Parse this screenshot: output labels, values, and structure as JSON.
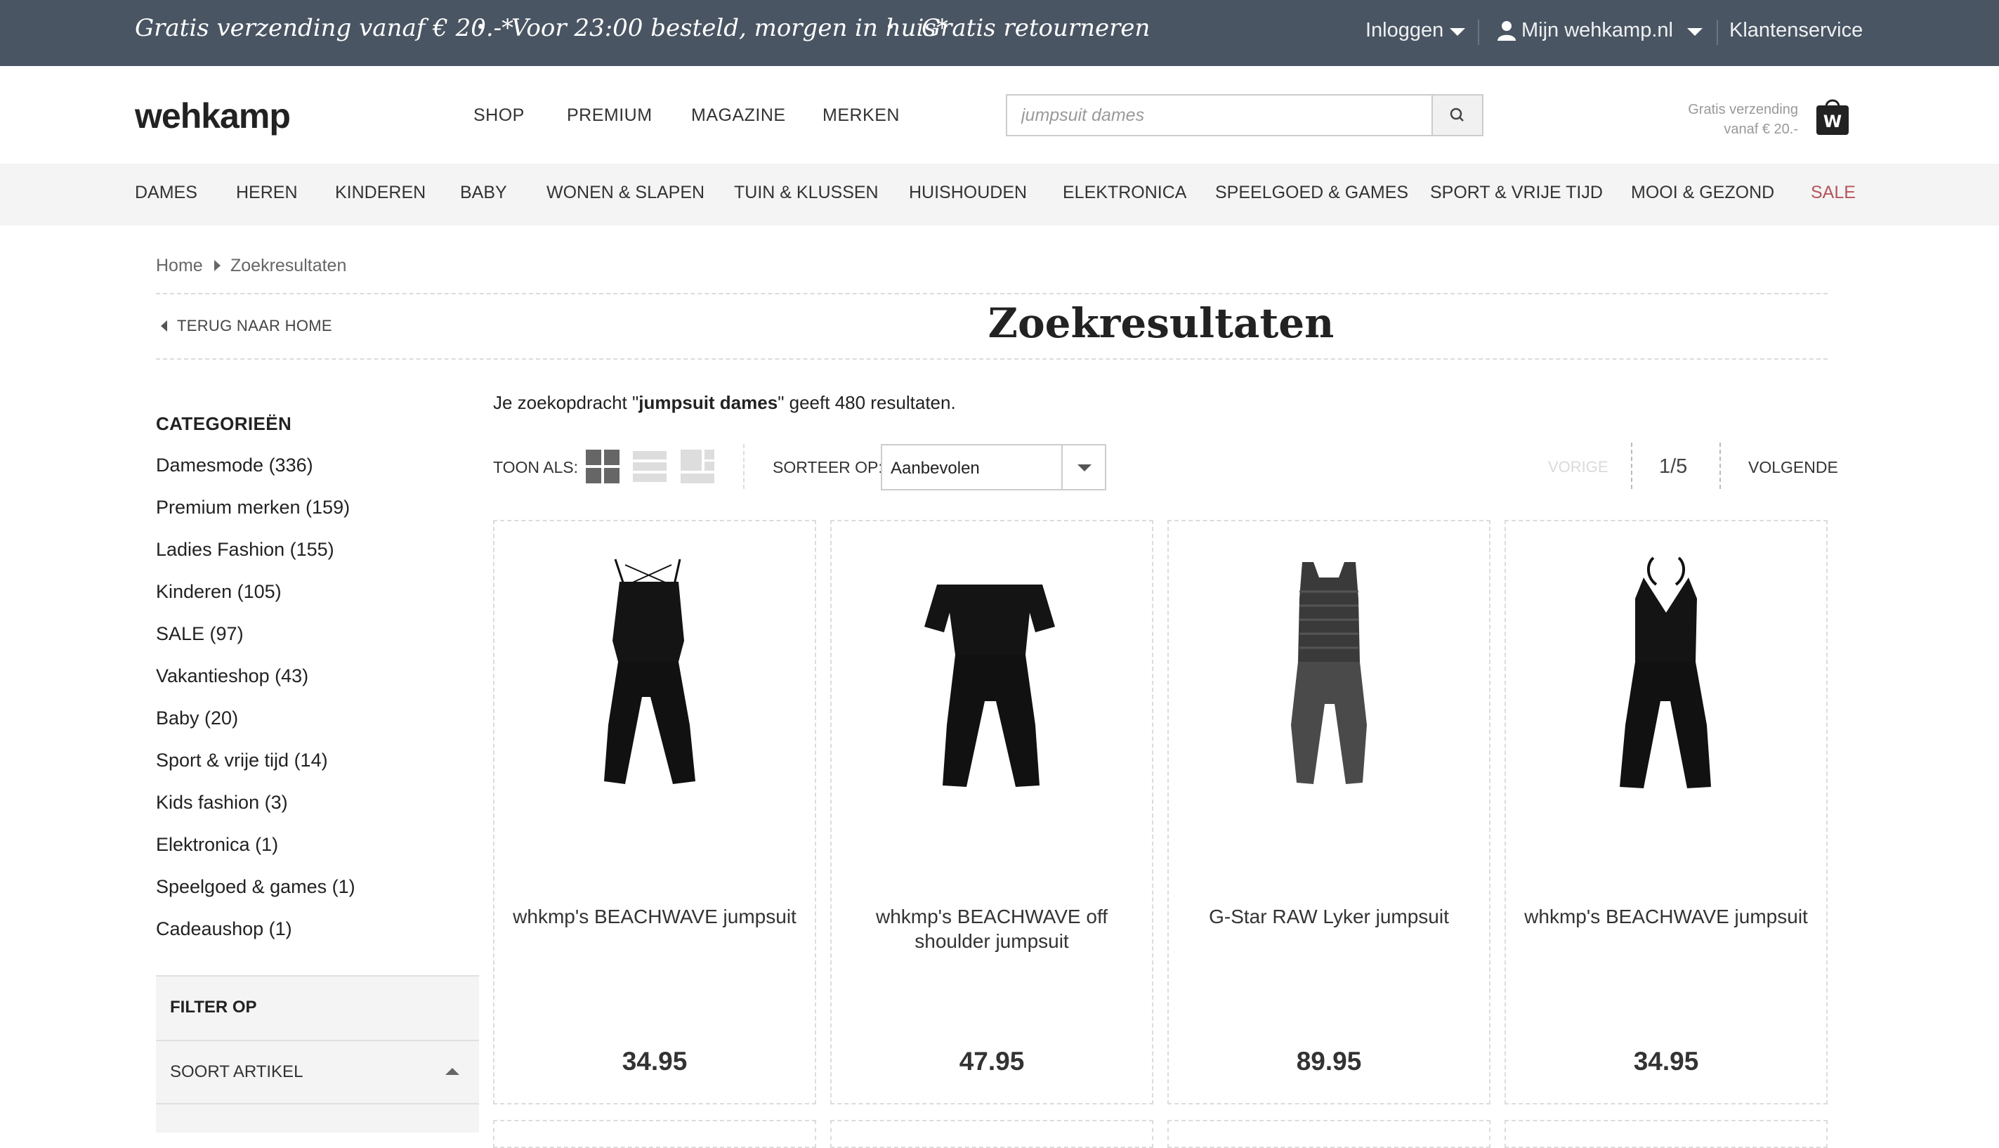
{
  "topbar": {
    "usps": [
      "Gratis verzending vanaf € 20.-*",
      "Voor 23:00 besteld, morgen in huis*",
      "Gratis retourneren"
    ],
    "login": "Inloggen",
    "account": "Mijn wehkamp.nl",
    "service": "Klantenservice",
    "icons": [
      "chevron-down-icon",
      "person-icon"
    ]
  },
  "header": {
    "logo": "wehkamp",
    "nav": [
      "SHOP",
      "PREMIUM",
      "MAGAZINE",
      "MERKEN"
    ],
    "search": {
      "value": "",
      "placeholder": "jumpsuit dames",
      "icon": "search-icon"
    },
    "shipping_line1": "Gratis verzending",
    "shipping_line2": "vanaf € 20.-",
    "bag_letter": "W"
  },
  "categories": [
    "DAMES",
    "HEREN",
    "KINDEREN",
    "BABY",
    "WONEN & SLAPEN",
    "TUIN & KLUSSEN",
    "HUISHOUDEN",
    "ELEKTRONICA",
    "SPEELGOED & GAMES",
    "SPORT & VRIJE TIJD",
    "MOOI & GEZOND",
    "SALE"
  ],
  "colors": {
    "topbar": "#4a5563",
    "sale": "#b5545c",
    "nav_bg": "#f4f4f4"
  },
  "breadcrumb": [
    "Home",
    "Zoekresultaten"
  ],
  "back_link": "TERUG NAAR HOME",
  "page_title": "Zoekresultaten",
  "sidebar": {
    "heading": "CATEGORIEËN",
    "items": [
      "Damesmode (336)",
      "Premium merken (159)",
      "Ladies Fashion (155)",
      "Kinderen (105)",
      "SALE (97)",
      "Vakantieshop (43)",
      "Baby (20)",
      "Sport & vrije tijd (14)",
      "Kids fashion (3)",
      "Elektronica (1)",
      "Speelgoed & games (1)",
      "Cadeaushop (1)"
    ],
    "filter_heading": "FILTER OP",
    "filter_section": "SOORT ARTIKEL"
  },
  "results": {
    "prefix": "Je zoekopdracht \"",
    "query": "jumpsuit dames",
    "suffix": "\" geeft 480 resultaten."
  },
  "toolbar": {
    "view_label": "TOON ALS:",
    "sort_label": "SORTEER OP:",
    "sort_value": "Aanbevolen",
    "prev": "VORIGE",
    "page": "1/5",
    "next": "VOLGENDE",
    "view_icons": [
      "grid-view-icon",
      "list-view-icon",
      "large-view-icon"
    ]
  },
  "products": [
    {
      "name": "whkmp's BEACHWAVE jumpsuit",
      "price": "34.95"
    },
    {
      "name": "whkmp's BEACHWAVE off shoulder jumpsuit",
      "price": "47.95"
    },
    {
      "name": "G-Star RAW Lyker jumpsuit",
      "price": "89.95"
    },
    {
      "name": "whkmp's BEACHWAVE jumpsuit",
      "price": "34.95"
    }
  ]
}
